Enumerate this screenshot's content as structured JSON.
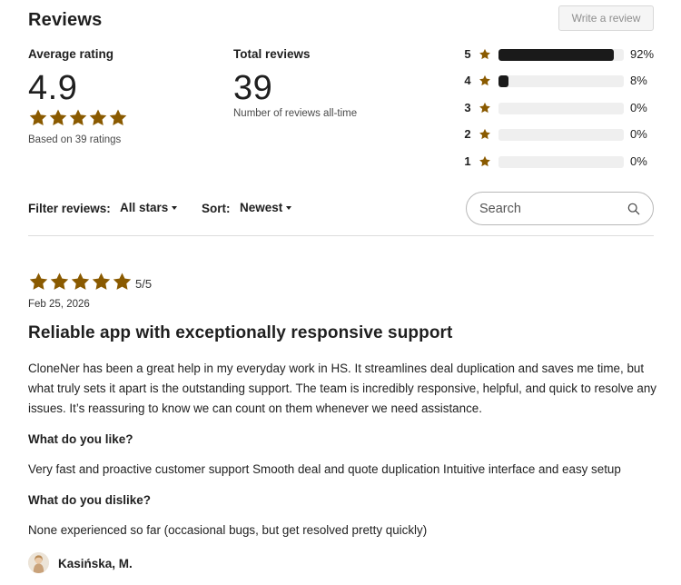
{
  "header": {
    "title": "Reviews",
    "write_review_label": "Write a review"
  },
  "summary": {
    "average_label": "Average rating",
    "average_value": "4.9",
    "average_stars": 5,
    "based_on": "Based on 39 ratings",
    "total_label": "Total reviews",
    "total_value": "39",
    "total_note": "Number of reviews all-time"
  },
  "distribution": [
    {
      "stars": "5",
      "percent_label": "92%",
      "fraction": 0.92
    },
    {
      "stars": "4",
      "percent_label": "8%",
      "fraction": 0.08
    },
    {
      "stars": "3",
      "percent_label": "0%",
      "fraction": 0
    },
    {
      "stars": "2",
      "percent_label": "0%",
      "fraction": 0
    },
    {
      "stars": "1",
      "percent_label": "0%",
      "fraction": 0
    }
  ],
  "filters": {
    "filter_label": "Filter reviews:",
    "filter_value": "All stars",
    "sort_label": "Sort:",
    "sort_value": "Newest",
    "search_placeholder": "Search"
  },
  "review": {
    "stars": 5,
    "score_text": "5/5",
    "date": "Feb 25, 2026",
    "title": "Reliable app with exceptionally responsive support",
    "body": "CloneNer has been a great help in my everyday work in HS. It streamlines deal duplication and saves me time, but what truly sets it apart is the outstanding support. The team is incredibly responsive, helpful, and quick to resolve any issues. It’s reassuring to know we can count on them whenever we need assistance.",
    "like_label": "What do you like?",
    "like_text": "Very fast and proactive customer support Smooth deal and quote duplication Intuitive interface and easy setup",
    "dislike_label": "What do you dislike?",
    "dislike_text": "None experienced so far (occasional bugs, but get resolved pretty quickly)",
    "author": "Kasińska, M."
  },
  "colors": {
    "star": "#8a5a00",
    "bar_fill": "#1a1a1a",
    "bar_track": "#efefef",
    "divider": "#dcdcdc"
  },
  "icons": {
    "star": "star-icon",
    "search": "search-icon",
    "caret": "chevron-down-icon"
  }
}
